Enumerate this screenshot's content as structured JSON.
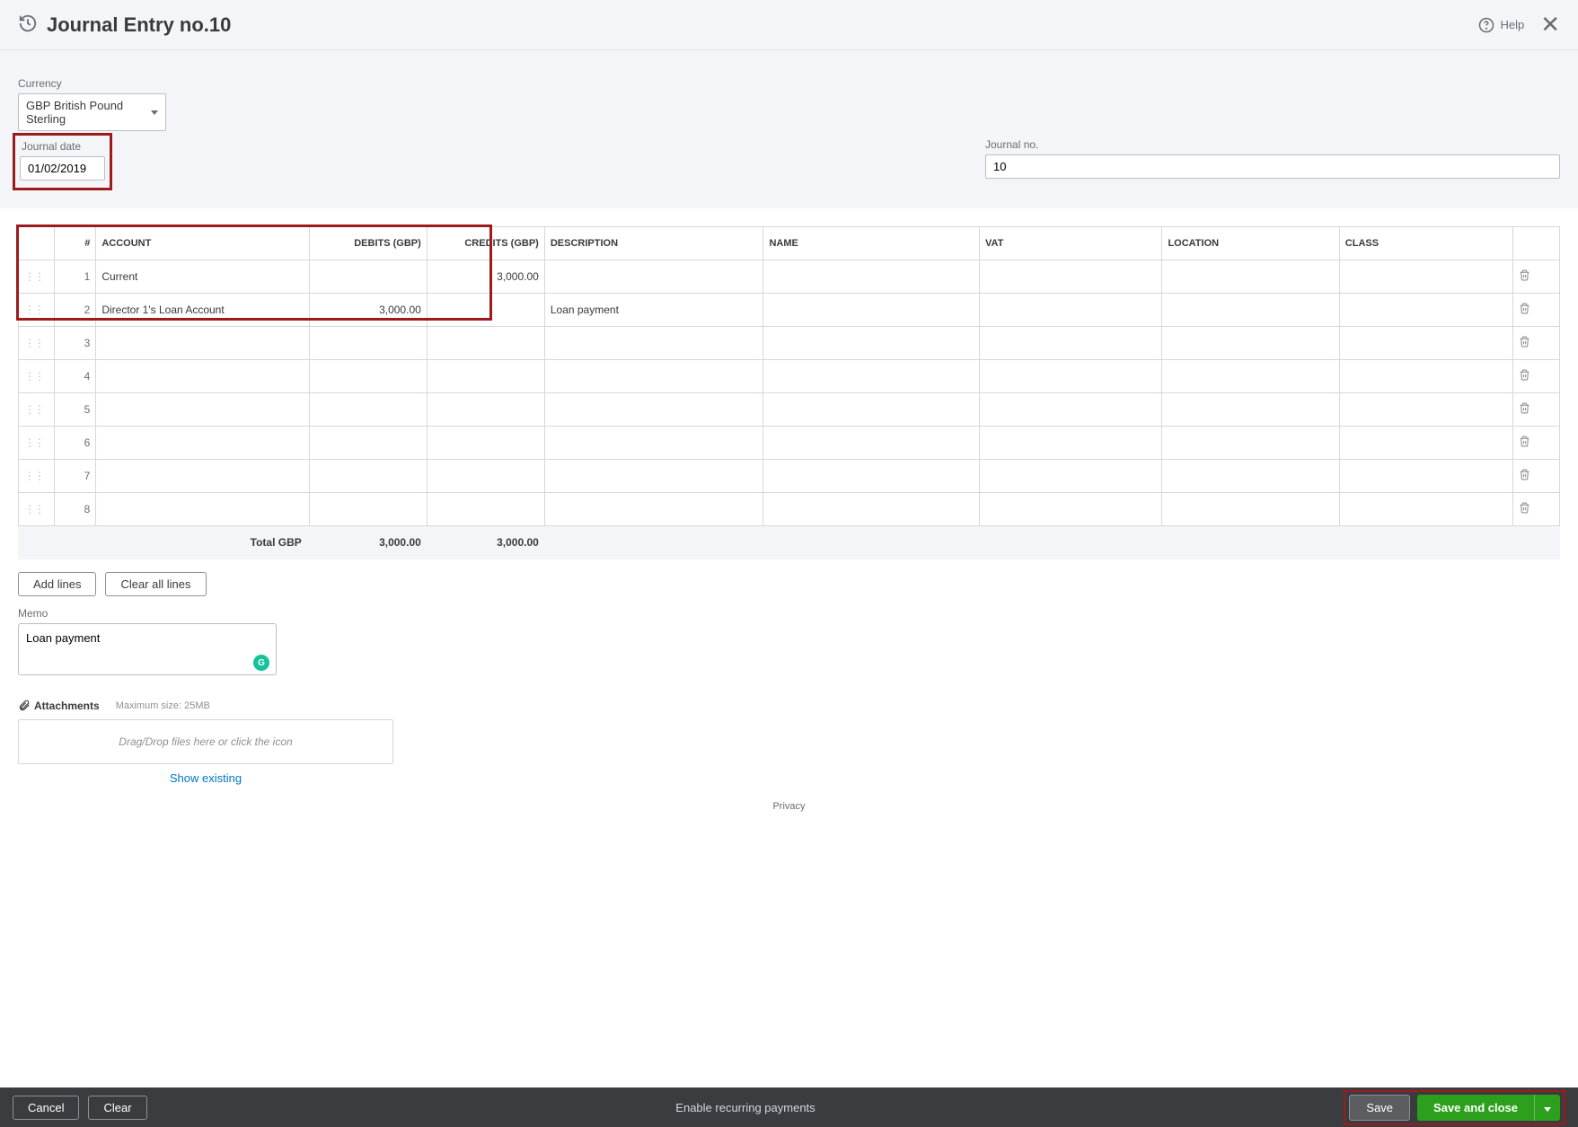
{
  "header": {
    "title": "Journal Entry no.10",
    "help_label": "Help"
  },
  "currency": {
    "label": "Currency",
    "value": "GBP British Pound Sterling"
  },
  "journal_date": {
    "label": "Journal date",
    "value": "01/02/2019"
  },
  "journal_no": {
    "label": "Journal no.",
    "value": "10"
  },
  "table": {
    "headers": {
      "num": "#",
      "account": "ACCOUNT",
      "debits": "DEBITS (GBP)",
      "credits": "CREDITS (GBP)",
      "description": "DESCRIPTION",
      "name": "NAME",
      "vat": "VAT",
      "location": "LOCATION",
      "class": "CLASS"
    },
    "rows": [
      {
        "num": "1",
        "account": "Current",
        "debits": "",
        "credits": "3,000.00",
        "description": "",
        "name": "",
        "vat": "",
        "location": "",
        "class": ""
      },
      {
        "num": "2",
        "account": "Director 1's Loan Account",
        "debits": "3,000.00",
        "credits": "",
        "description": "Loan payment",
        "name": "",
        "vat": "",
        "location": "",
        "class": ""
      },
      {
        "num": "3",
        "account": "",
        "debits": "",
        "credits": "",
        "description": "",
        "name": "",
        "vat": "",
        "location": "",
        "class": ""
      },
      {
        "num": "4",
        "account": "",
        "debits": "",
        "credits": "",
        "description": "",
        "name": "",
        "vat": "",
        "location": "",
        "class": ""
      },
      {
        "num": "5",
        "account": "",
        "debits": "",
        "credits": "",
        "description": "",
        "name": "",
        "vat": "",
        "location": "",
        "class": ""
      },
      {
        "num": "6",
        "account": "",
        "debits": "",
        "credits": "",
        "description": "",
        "name": "",
        "vat": "",
        "location": "",
        "class": ""
      },
      {
        "num": "7",
        "account": "",
        "debits": "",
        "credits": "",
        "description": "",
        "name": "",
        "vat": "",
        "location": "",
        "class": ""
      },
      {
        "num": "8",
        "account": "",
        "debits": "",
        "credits": "",
        "description": "",
        "name": "",
        "vat": "",
        "location": "",
        "class": ""
      }
    ],
    "totals": {
      "label": "Total GBP",
      "debits": "3,000.00",
      "credits": "3,000.00"
    }
  },
  "buttons": {
    "add_lines": "Add lines",
    "clear_all_lines": "Clear all lines"
  },
  "memo": {
    "label": "Memo",
    "value": "Loan payment"
  },
  "attachments": {
    "label": "Attachments",
    "max_size": "Maximum size: 25MB",
    "drop_hint": "Drag/Drop files here or click the icon",
    "show_existing": "Show existing"
  },
  "privacy": "Privacy",
  "footer": {
    "cancel": "Cancel",
    "clear": "Clear",
    "recurring": "Enable recurring payments",
    "save": "Save",
    "save_close": "Save and close"
  }
}
